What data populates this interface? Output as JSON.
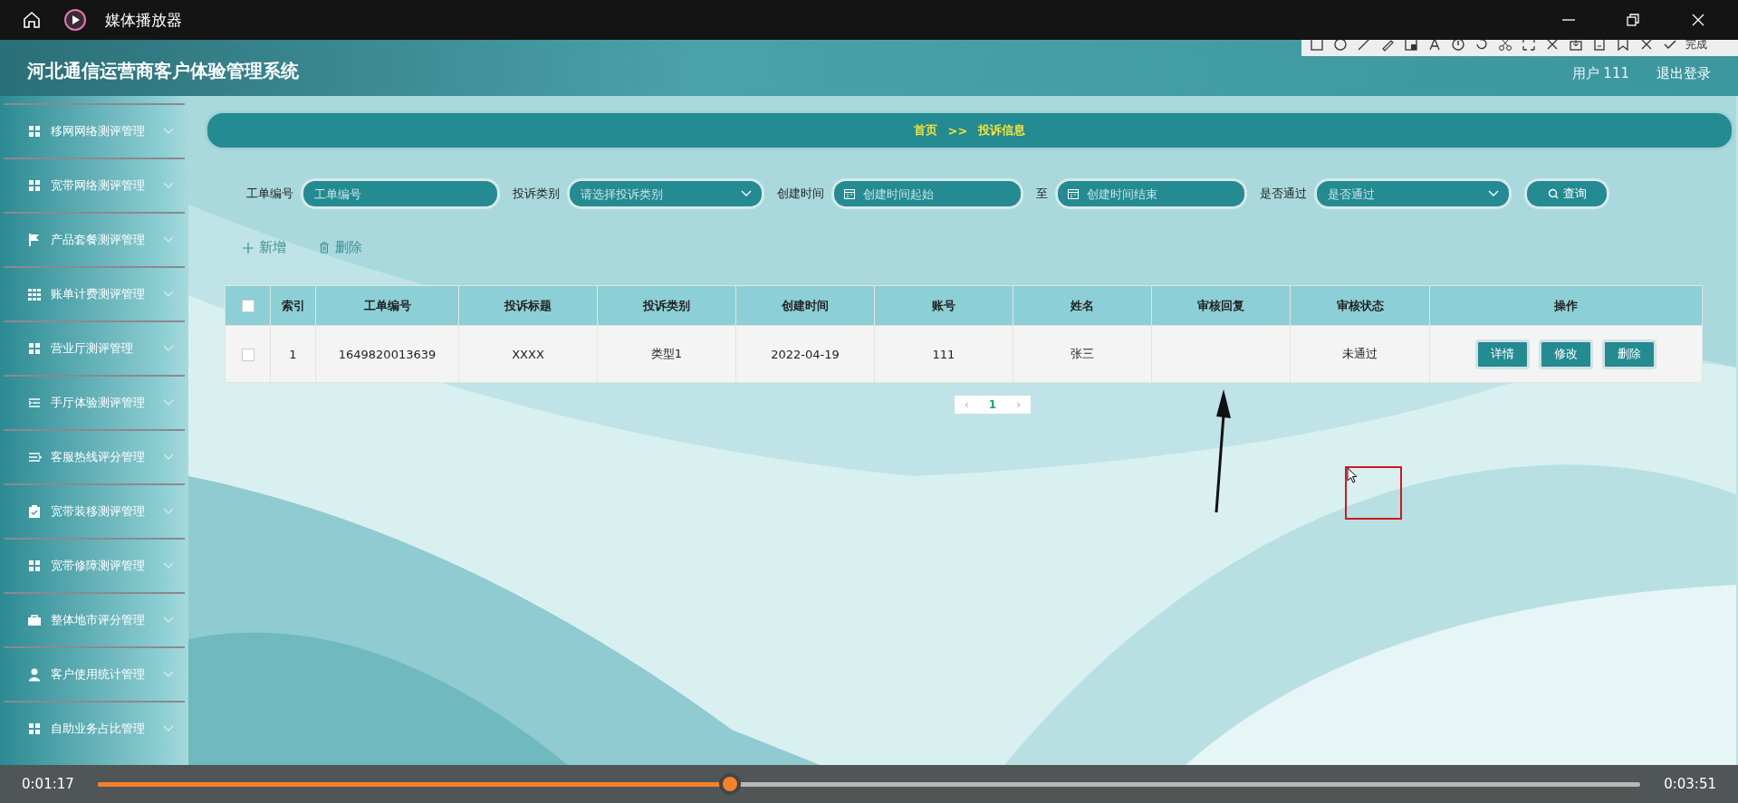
{
  "player": {
    "title": "媒体播放器",
    "elapsed": "0:01:17",
    "duration": "0:03:51",
    "level": 0.41
  },
  "capture_toolbar": {
    "done": "完成"
  },
  "app": {
    "title": "河北通信运营商客户体验管理系统",
    "user": "用户 111",
    "logout": "退出登录"
  },
  "sidebar": {
    "items": [
      {
        "label": "移网网络测评管理",
        "expanded": false
      },
      {
        "label": "宽带网络测评管理",
        "expanded": false
      },
      {
        "label": "产品套餐测评管理",
        "expanded": false
      },
      {
        "label": "账单计费测评管理",
        "expanded": false
      },
      {
        "label": "营业厅测评管理",
        "expanded": false
      },
      {
        "label": "手厅体验测评管理",
        "expanded": false
      },
      {
        "label": "客服热线评分管理",
        "expanded": false
      },
      {
        "label": "宽带装移测评管理",
        "expanded": false
      },
      {
        "label": "宽带修障测评管理",
        "expanded": false
      },
      {
        "label": "整体地市评分管理",
        "expanded": false
      },
      {
        "label": "客户使用统计管理",
        "expanded": false
      },
      {
        "label": "自助业务占比管理",
        "expanded": false
      }
    ]
  },
  "breadcrumb": [
    "首页",
    ">>",
    "投诉信息"
  ],
  "filters": [
    {
      "kind": "text",
      "label": "工单编号",
      "placeholder": "工单编号"
    },
    {
      "kind": "select",
      "label": "投诉类别",
      "placeholder": "请选择投诉类别"
    },
    {
      "kind": "date",
      "label": "创建时间",
      "placeholder": "创建时间起始"
    },
    {
      "kind": "date",
      "label": "至",
      "placeholder": "创建时间结束"
    },
    {
      "kind": "select",
      "label": "是否通过",
      "placeholder": "是否通过"
    }
  ],
  "search_button": "查询",
  "actions": [
    {
      "kind": "add",
      "label": "新增"
    },
    {
      "kind": "delete",
      "label": "删除"
    }
  ],
  "table": {
    "select_all_checked": false,
    "columns": [
      "索引",
      "工单编号",
      "投诉标题",
      "投诉类别",
      "创建时间",
      "账号",
      "姓名",
      "审核回复",
      "审核状态",
      "操作"
    ],
    "rows": [
      {
        "checked": false,
        "cells": [
          "1",
          "1649820013639",
          "XXXX",
          "类型1",
          "2022-04-19",
          "111",
          "张三",
          "",
          "未通过"
        ],
        "buttons": [
          "详情",
          "修改",
          "删除"
        ]
      }
    ]
  },
  "pagination": {
    "prev": "‹",
    "pages": [
      {
        "label": "1",
        "selected": true
      }
    ],
    "next": "›"
  }
}
